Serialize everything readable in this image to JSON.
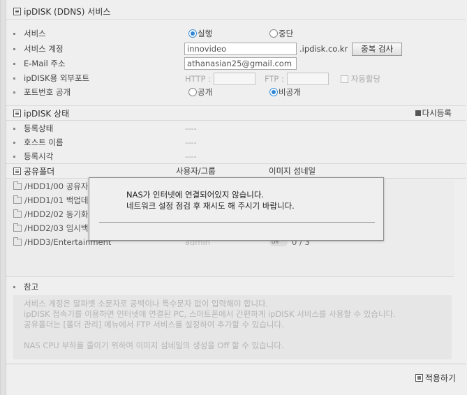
{
  "ddns": {
    "title": "ipDISK (DDNS) 서비스",
    "service_label": "서비스",
    "run_label": "실행",
    "stop_label": "중단",
    "account_label": "서비스 계정",
    "account_value": "innovideo",
    "domain_suffix": ".ipdisk.co.kr",
    "dup_check_button": "중복 검사",
    "email_label": "E-Mail 주소",
    "email_value": "athanasian25@gmail.com",
    "port_label": "ipDISK용 외부포트",
    "http_label": "HTTP :",
    "ftp_label": "FTP :",
    "auto_assign_label": "자동할당",
    "port_public_label": "포트번호 공개",
    "public_label": "공개",
    "private_label": "비공개"
  },
  "status": {
    "title": "ipDISK 상태",
    "reregister": "다시등록",
    "reg_state_label": "등록상태",
    "reg_state_value": "----",
    "host_label": "호스트 이름",
    "host_value": "----",
    "reg_time_label": "등록시각",
    "reg_time_value": "----"
  },
  "shared": {
    "title": "공유폴더",
    "col_user": "사용자/그룹",
    "col_thumb": "이미지 섬네일",
    "folders": [
      {
        "name": "/HDD1/00 공유자"
      },
      {
        "name": "/HDD1/01 백업데"
      },
      {
        "name": "/HDD2/02 동기화"
      },
      {
        "name": "/HDD2/03 임시백"
      },
      {
        "name": "/HDD3/Entertainment",
        "user": "admin",
        "toggle": "Off",
        "count": "0 / 3"
      }
    ]
  },
  "note": {
    "title": "참고",
    "line1": "서비스 계정은 알파벳 소문자로 공백이나 특수문자 없이 입력해야 합니다.",
    "line2": "ipDISK 접속기를 이용하면 인터넷에 연결된 PC, 스마트폰에서 간편하게 ipDISK 서비스를 사용할 수 있습니다.",
    "line3": "공유폴더는 [폴더 관리] 메뉴에서 FTP 서비스를 설정하여 추가할 수 있습니다.",
    "line4": "NAS CPU 부하를 줄이기 위하여 이미지 섬네일의 생성을 Off 할 수 있습니다."
  },
  "modal": {
    "line1": "NAS가 인터넷에 연결되어있지 않습니다.",
    "line2": "네트워크 설정 점검 후 재시도 해 주시기 바랍니다."
  },
  "footer": {
    "apply_label": "적용하기"
  }
}
